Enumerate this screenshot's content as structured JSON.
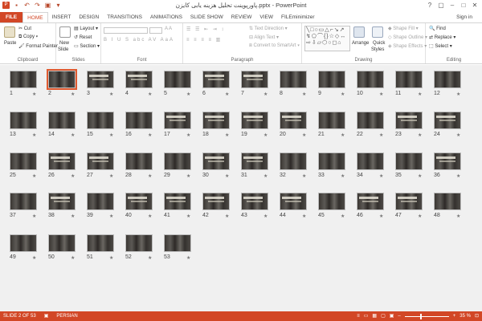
{
  "window": {
    "title": "پاورپوینت تحلیل هزینه یابی کایزن.pptx - PowerPoint",
    "controls": [
      "?",
      "▢",
      "–",
      "□",
      "✕"
    ]
  },
  "qat": {
    "icons": [
      "powerpoint-logo-icon",
      "save-icon",
      "undo-icon",
      "redo-icon",
      "start-slideshow-icon",
      "customize-qat-icon"
    ]
  },
  "tabs": [
    "FILE",
    "HOME",
    "INSERT",
    "DESIGN",
    "TRANSITIONS",
    "ANIMATIONS",
    "SLIDE SHOW",
    "REVIEW",
    "VIEW",
    "FILEminimizer"
  ],
  "active_tab": "HOME",
  "signin": "Sign in",
  "ribbon": {
    "clipboard": {
      "label": "Clipboard",
      "paste": "Paste",
      "cut": "Cut",
      "copy": "Copy",
      "format_painter": "Format Painter"
    },
    "slides": {
      "label": "Slides",
      "new_slide": "New",
      "new_slide2": "Slide",
      "layout": "Layout",
      "reset": "Reset",
      "section": "Section"
    },
    "font": {
      "label": "Font"
    },
    "paragraph": {
      "label": "Paragraph",
      "text_direction": "Text Direction",
      "align_text": "Align Text",
      "convert_smartart": "Convert to SmartArt"
    },
    "drawing": {
      "label": "Drawing",
      "arrange": "Arrange",
      "quick_styles": "Quick",
      "quick_styles2": "Styles",
      "shape_fill": "Shape Fill",
      "shape_outline": "Shape Outline",
      "shape_effects": "Shape Effects"
    },
    "editing": {
      "label": "Editing",
      "find": "Find",
      "replace": "Replace",
      "select": "Select"
    }
  },
  "slides": {
    "count": 53,
    "selected": 2,
    "light_slides": [
      3,
      4,
      6,
      7,
      17,
      18,
      19,
      20,
      23,
      24,
      26,
      27,
      30,
      31,
      36,
      38,
      40,
      41,
      42,
      43,
      44,
      46,
      47
    ]
  },
  "status": {
    "slide_info": "SLIDE 2 OF 53",
    "language": "PERSIAN",
    "zoom": "35 %",
    "zoom_level": 0.35
  }
}
